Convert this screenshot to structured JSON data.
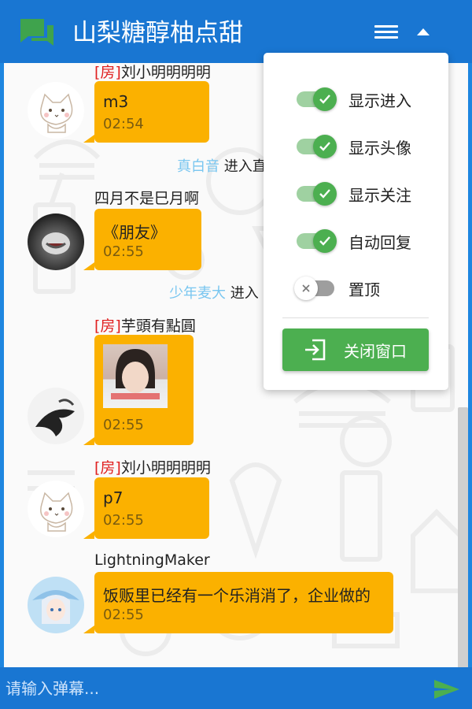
{
  "header": {
    "title": "山梨糖醇柚点甜",
    "logo_icon": "chat-bubbles-icon",
    "menu_icon": "hamburger-icon",
    "collapse_icon": "caret-up-icon",
    "color": "#1976d2"
  },
  "messages": [
    {
      "tag": "[房]",
      "nick": "刘小明明明明",
      "text": "m3",
      "time": "02:54",
      "avatar": "cat-avatar"
    },
    {
      "enter": true,
      "who": "真白音",
      "suffix": " 进入直"
    },
    {
      "tag": "",
      "nick": "四月不是巳月啊",
      "text": "《朋友》",
      "time": "02:55",
      "avatar": "dark-photo-avatar"
    },
    {
      "enter": true,
      "who": "少年麦大",
      "suffix": " 进入"
    },
    {
      "tag": "[房]",
      "nick": "芋頭有點圓",
      "image": "photo-message-image",
      "time": "02:55",
      "avatar": "ink-avatar"
    },
    {
      "tag": "[房]",
      "nick": "刘小明明明明",
      "text": "p7",
      "time": "02:55",
      "avatar": "cat-avatar"
    },
    {
      "tag": "",
      "nick": "LightningMaker",
      "text": "饭贩里已经有一个乐消消了，企业做的",
      "time": "02:55",
      "avatar": "anime-girl-avatar"
    }
  ],
  "popup": {
    "options": [
      {
        "label": "显示进入",
        "on": true
      },
      {
        "label": "显示头像",
        "on": true
      },
      {
        "label": "显示关注",
        "on": true
      },
      {
        "label": "自动回复",
        "on": true
      },
      {
        "label": "置顶",
        "on": false
      }
    ],
    "close_label": "关闭窗口",
    "close_icon": "exit-icon"
  },
  "footer": {
    "placeholder": "请输入弹幕...",
    "send_icon": "send-icon"
  },
  "colors": {
    "bubble": "#fbb100",
    "accent_green": "#4caf50",
    "room_tag": "#e02020",
    "enter_name": "#79c6f0"
  }
}
